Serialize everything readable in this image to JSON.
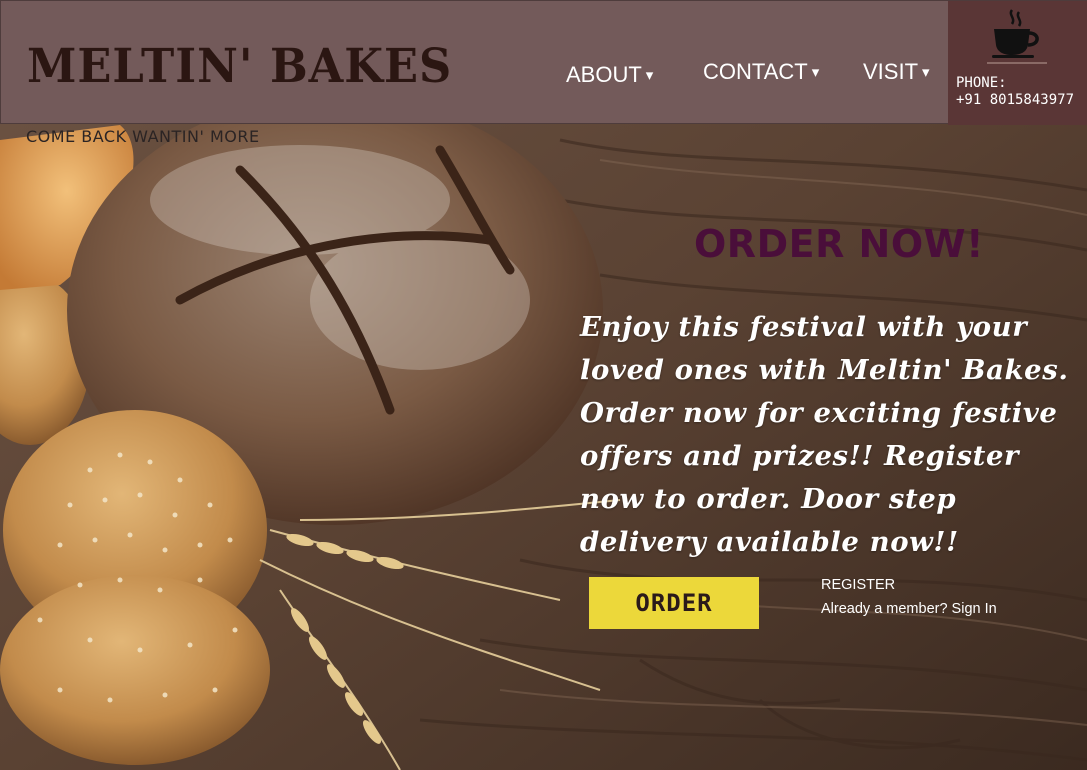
{
  "header": {
    "brand": "MELTIN' BAKES",
    "tagline": "COME BACK WANTIN' MORE",
    "nav": {
      "about": "ABOUT",
      "contact": "CONTACT",
      "visit": "VISIT",
      "caret": "▾"
    },
    "phone": {
      "label": "PHONE:",
      "number": "+91 8015843977",
      "icon": "coffee-cup-icon"
    }
  },
  "promo": {
    "headline": "ORDER NOW!",
    "body": "Enjoy this festival with your loved ones with Meltin' Bakes. Order now for exciting festive offers and prizes!! Register now to order. Door step delivery available now!!"
  },
  "actions": {
    "order_label": "ORDER",
    "register_label": "REGISTER",
    "signin_label": "Already a member? Sign In"
  },
  "colors": {
    "header_bg": "#735a5a",
    "phone_bg": "#5a3636",
    "headline": "#4a0e3a",
    "order_button": "#ecd83a"
  }
}
